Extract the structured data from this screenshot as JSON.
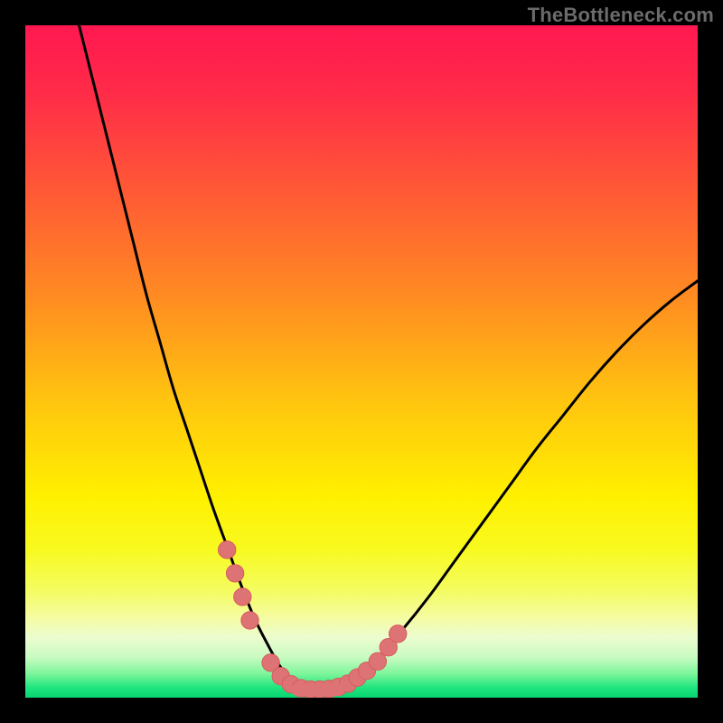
{
  "attribution": "TheBottleneck.com",
  "colors": {
    "frame": "#000000",
    "curve_stroke": "#000000",
    "marker_fill": "#dd7374",
    "marker_stroke": "#d85c5e",
    "attribution_text": "#6b6b6b"
  },
  "chart_data": {
    "type": "line",
    "title": "",
    "xlabel": "",
    "ylabel": "",
    "xlim": [
      0,
      100
    ],
    "ylim": [
      0,
      100
    ],
    "background_gradient_stops": [
      {
        "offset": 0.0,
        "color": "#ff1850"
      },
      {
        "offset": 0.1,
        "color": "#ff2b48"
      },
      {
        "offset": 0.25,
        "color": "#ff5a35"
      },
      {
        "offset": 0.4,
        "color": "#ff8a22"
      },
      {
        "offset": 0.55,
        "color": "#ffc210"
      },
      {
        "offset": 0.7,
        "color": "#fff000"
      },
      {
        "offset": 0.78,
        "color": "#f8fa20"
      },
      {
        "offset": 0.84,
        "color": "#f4fc60"
      },
      {
        "offset": 0.88,
        "color": "#f5fca0"
      },
      {
        "offset": 0.91,
        "color": "#ecfccf"
      },
      {
        "offset": 0.94,
        "color": "#c8fbc1"
      },
      {
        "offset": 0.965,
        "color": "#7bf59a"
      },
      {
        "offset": 0.985,
        "color": "#1fe57f"
      },
      {
        "offset": 1.0,
        "color": "#07d471"
      }
    ],
    "series": [
      {
        "name": "bottleneck-curve",
        "x": [
          8,
          10,
          12,
          14,
          16,
          18,
          20,
          22,
          24,
          26,
          28,
          30,
          32,
          34,
          36,
          38,
          40,
          42,
          45,
          48,
          52,
          56,
          60,
          64,
          68,
          72,
          76,
          80,
          84,
          88,
          92,
          96,
          100
        ],
        "y": [
          100,
          92,
          84,
          76,
          68,
          60,
          53,
          46,
          40,
          34,
          28,
          22.5,
          17,
          12,
          8,
          4.5,
          2.2,
          1.2,
          1.2,
          2.4,
          5.5,
          10,
          15,
          20.5,
          26,
          31.5,
          37,
          42,
          47,
          51.5,
          55.5,
          59,
          62
        ]
      }
    ],
    "markers": [
      {
        "x": 30.0,
        "y": 22.0,
        "r": 1.3
      },
      {
        "x": 31.2,
        "y": 18.5,
        "r": 1.3
      },
      {
        "x": 32.3,
        "y": 15.0,
        "r": 1.3
      },
      {
        "x": 33.4,
        "y": 11.5,
        "r": 1.3
      },
      {
        "x": 36.5,
        "y": 5.2,
        "r": 1.3
      },
      {
        "x": 38.0,
        "y": 3.2,
        "r": 1.3
      },
      {
        "x": 39.5,
        "y": 2.0,
        "r": 1.3
      },
      {
        "x": 41.0,
        "y": 1.4,
        "r": 1.3
      },
      {
        "x": 42.4,
        "y": 1.2,
        "r": 1.3
      },
      {
        "x": 43.8,
        "y": 1.2,
        "r": 1.3
      },
      {
        "x": 45.2,
        "y": 1.3,
        "r": 1.3
      },
      {
        "x": 46.6,
        "y": 1.6,
        "r": 1.3
      },
      {
        "x": 48.0,
        "y": 2.1,
        "r": 1.3
      },
      {
        "x": 49.4,
        "y": 3.0,
        "r": 1.3
      },
      {
        "x": 50.8,
        "y": 4.0,
        "r": 1.3
      },
      {
        "x": 52.4,
        "y": 5.4,
        "r": 1.3
      },
      {
        "x": 54.0,
        "y": 7.5,
        "r": 1.3
      },
      {
        "x": 55.4,
        "y": 9.5,
        "r": 1.3
      }
    ],
    "valley_floor": {
      "x_start": 40.5,
      "x_end": 46.5,
      "y": 1.2
    }
  }
}
